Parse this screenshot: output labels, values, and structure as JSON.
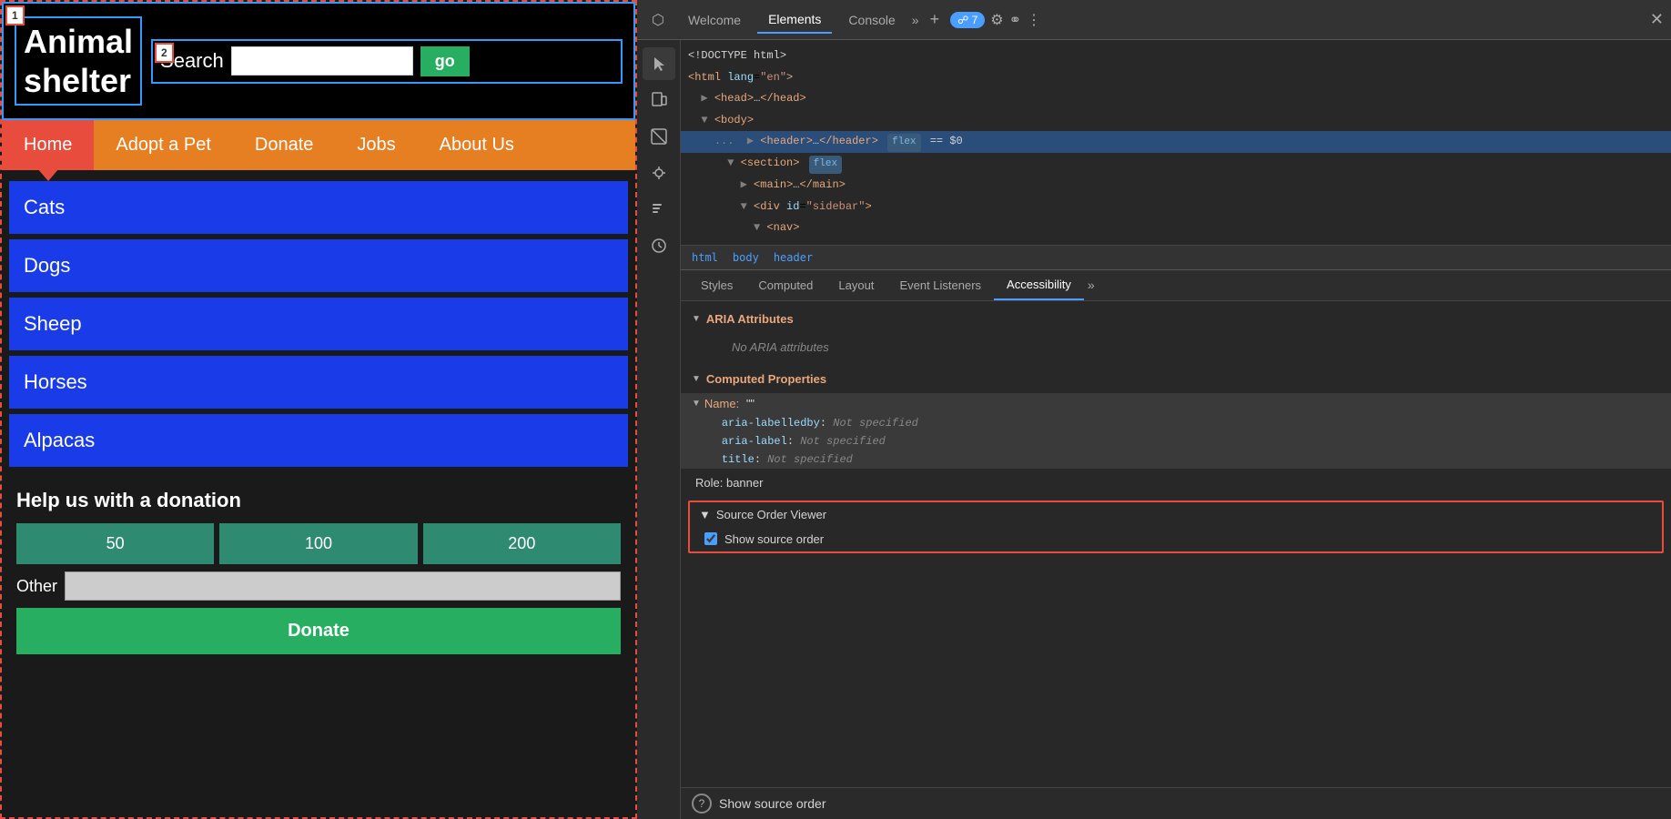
{
  "left_panel": {
    "header": {
      "logo_text": "Animal shelter",
      "order_badge_1": "1",
      "order_badge_2": "2",
      "search_label": "Search",
      "go_button": "go"
    },
    "nav": {
      "items": [
        {
          "label": "Home",
          "active": true
        },
        {
          "label": "Adopt a Pet",
          "active": false
        },
        {
          "label": "Donate",
          "active": false
        },
        {
          "label": "Jobs",
          "active": false
        },
        {
          "label": "About Us",
          "active": false
        }
      ]
    },
    "animals": [
      "Cats",
      "Dogs",
      "Sheep",
      "Horses",
      "Alpacas"
    ],
    "donation": {
      "title": "Help us with a donation",
      "amounts": [
        "50",
        "100",
        "200"
      ],
      "other_label": "Other",
      "donate_button": "Donate"
    }
  },
  "devtools": {
    "toolbar": {
      "tabs": [
        "Welcome",
        "Elements",
        "Console"
      ],
      "active_tab": "Elements",
      "badge_count": "7",
      "more_label": "»",
      "new_tab_label": "+",
      "close_label": "✕"
    },
    "html_tree": {
      "lines": [
        {
          "indent": 0,
          "html": "<!DOCTYPE html>",
          "selected": false
        },
        {
          "indent": 0,
          "html": "<html lang=\"en\">",
          "selected": false
        },
        {
          "indent": 1,
          "html": "▶ <head>…</head>",
          "selected": false
        },
        {
          "indent": 1,
          "html": "▼ <body>",
          "selected": false
        },
        {
          "indent": 2,
          "html": "... ▶ <header>…</header>",
          "badge": "flex",
          "equals": "== $0",
          "selected": true
        },
        {
          "indent": 3,
          "html": "▼ <section>",
          "badge": "flex",
          "selected": false
        },
        {
          "indent": 4,
          "html": "▶ <main>…</main>",
          "selected": false
        },
        {
          "indent": 4,
          "html": "▼ <div id=\"sidebar\">",
          "selected": false
        },
        {
          "indent": 5,
          "html": "▼ <nav>",
          "selected": false
        }
      ]
    },
    "breadcrumb": [
      "html",
      "body",
      "header"
    ],
    "sub_tabs": [
      "Styles",
      "Computed",
      "Layout",
      "Event Listeners",
      "Accessibility",
      "»"
    ],
    "active_sub_tab": "Accessibility",
    "accessibility": {
      "aria_section_title": "ARIA Attributes",
      "no_aria_text": "No ARIA attributes",
      "computed_section_title": "Computed Properties",
      "name_label": "Name:",
      "name_value": "\"\"",
      "aria_labelledby_label": "aria-labelledby:",
      "aria_labelledby_value": "Not specified",
      "aria_label_label": "aria-label:",
      "aria_label_value": "Not specified",
      "title_label": "title:",
      "title_value": "Not specified",
      "role_label": "Role:",
      "role_value": "banner"
    },
    "source_order_viewer": {
      "title": "Source Order Viewer",
      "show_label": "Show source order",
      "checked": true
    },
    "bottom": {
      "help_icon": "?",
      "show_source_text": "Show source order"
    }
  }
}
